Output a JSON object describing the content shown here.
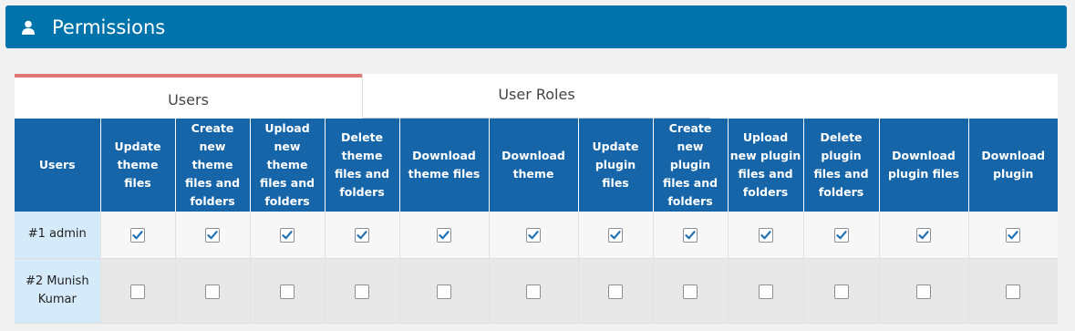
{
  "header": {
    "title": "Permissions",
    "icon": "user-icon"
  },
  "tabs": [
    {
      "label": "Users",
      "active": true
    },
    {
      "label": "User Roles",
      "active": false
    }
  ],
  "table": {
    "columns": [
      "Users",
      "Update theme files",
      "Create new theme files and folders",
      "Upload new theme files and folders",
      "Delete theme files and folders",
      "Download theme files",
      "Download theme",
      "Update plugin files",
      "Create new plugin files and folders",
      "Upload new plugin files and folders",
      "Delete plugin files and folders",
      "Download plugin files",
      "Download plugin"
    ],
    "rows": [
      {
        "user": "#1 admin",
        "checked": [
          true,
          true,
          true,
          true,
          true,
          true,
          true,
          true,
          true,
          true,
          true,
          true
        ]
      },
      {
        "user": "#2 Munish Kumar",
        "checked": [
          false,
          false,
          false,
          false,
          false,
          false,
          false,
          false,
          false,
          false,
          false,
          false
        ]
      }
    ]
  },
  "colors": {
    "header_bg": "#0073aa",
    "table_header_bg": "#1565a8",
    "active_tab_accent": "#e07878",
    "check": "#2271b1"
  }
}
